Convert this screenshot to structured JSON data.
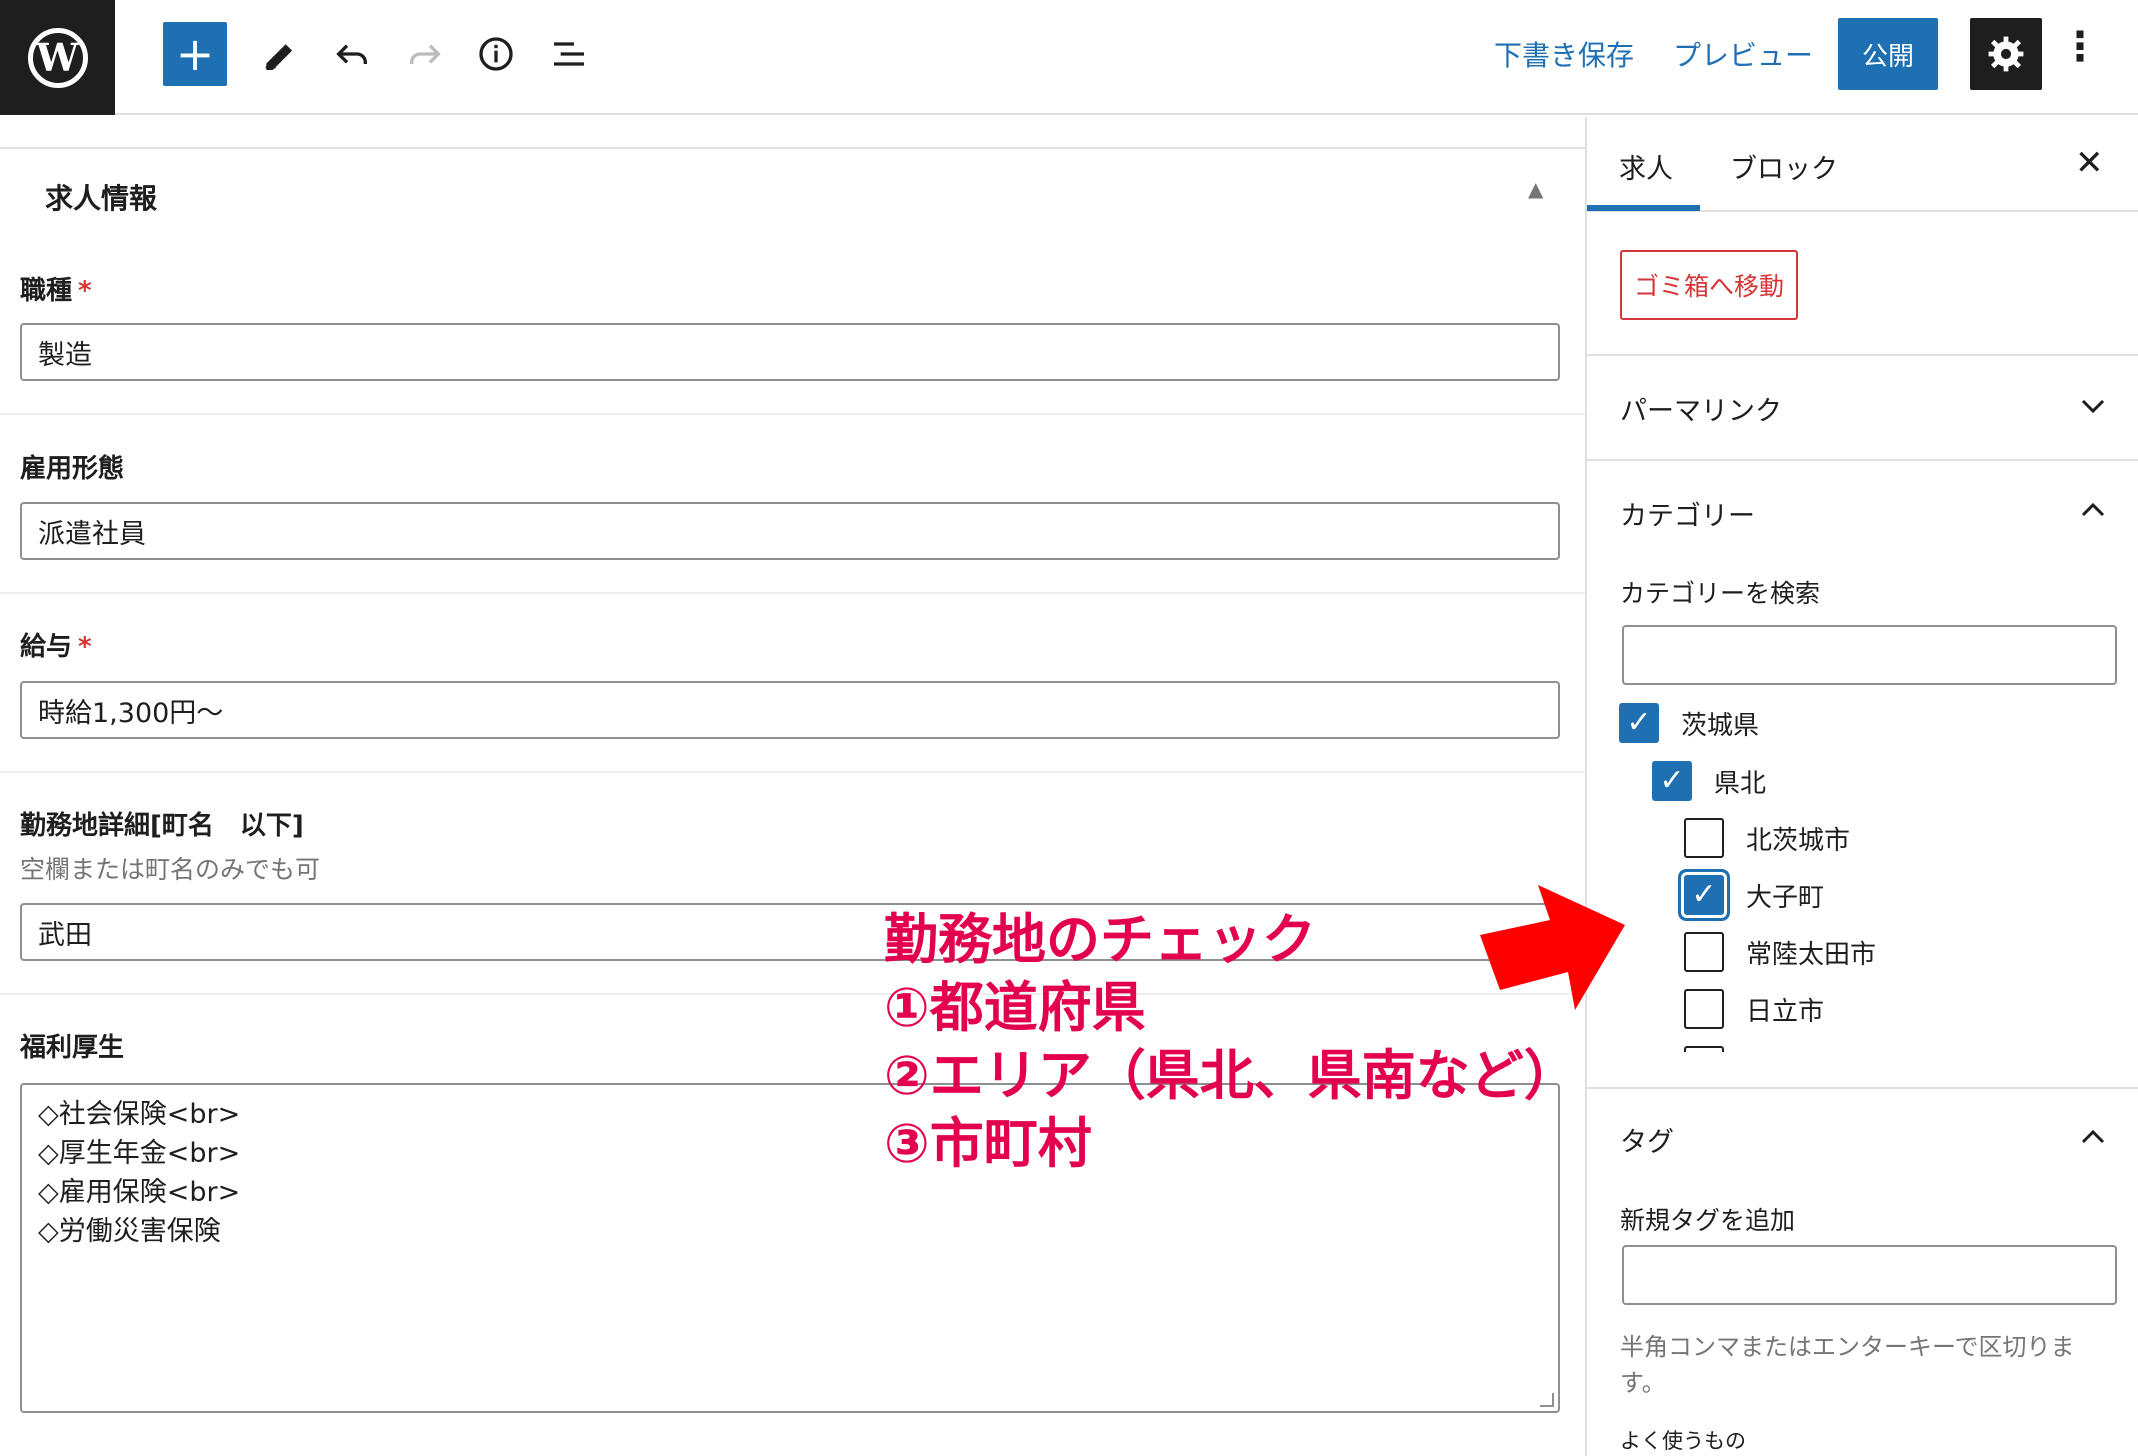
{
  "topbar": {
    "logo_icon": "wordpress-logo-icon",
    "save_draft": "下書き保存",
    "preview": "プレビュー",
    "publish": "公開"
  },
  "panel": {
    "title": "求人情報"
  },
  "fields": {
    "job_type_label": "職種",
    "job_type_value": "製造",
    "employment_label": "雇用形態",
    "employment_value": "派遣社員",
    "salary_label": "給与",
    "salary_value": "時給1,300円〜",
    "location_label": "勤務地詳細[町名　以下]",
    "location_desc": "空欄または町名のみでも可",
    "location_value": "武田",
    "welfare_label": "福利厚生",
    "welfare_lines": [
      "◇社会保険<br>",
      "◇厚生年金<br>",
      "◇雇用保険<br>",
      "◇労働災害保険"
    ],
    "required_mark": "*"
  },
  "sidebar": {
    "tab_post": "求人",
    "tab_block": "ブロック",
    "trash": "ゴミ箱へ移動",
    "permalink": "パーマリンク",
    "category": "カテゴリー",
    "category_search_label": "カテゴリーを検索",
    "categories": [
      {
        "label": "茨城県",
        "checked": true,
        "level": 0
      },
      {
        "label": "県北",
        "checked": true,
        "level": 1
      },
      {
        "label": "北茨城市",
        "checked": false,
        "level": 2
      },
      {
        "label": "大子町",
        "checked": true,
        "level": 2
      },
      {
        "label": "常陸太田市",
        "checked": false,
        "level": 2
      },
      {
        "label": "日立市",
        "checked": false,
        "level": 2
      }
    ],
    "tags": "タグ",
    "add_tag_label": "新規タグを追加",
    "tag_hint": "半角コンマまたはエンターキーで区切ります。",
    "most_used": "よく使うもの"
  },
  "annotation": {
    "line1": "勤務地のチェック",
    "line2": "①都道府県",
    "line3": "②エリア（県北、県南など）",
    "line4": "③市町村",
    "color": "#e3004f",
    "arrow_color": "#ff0000"
  }
}
